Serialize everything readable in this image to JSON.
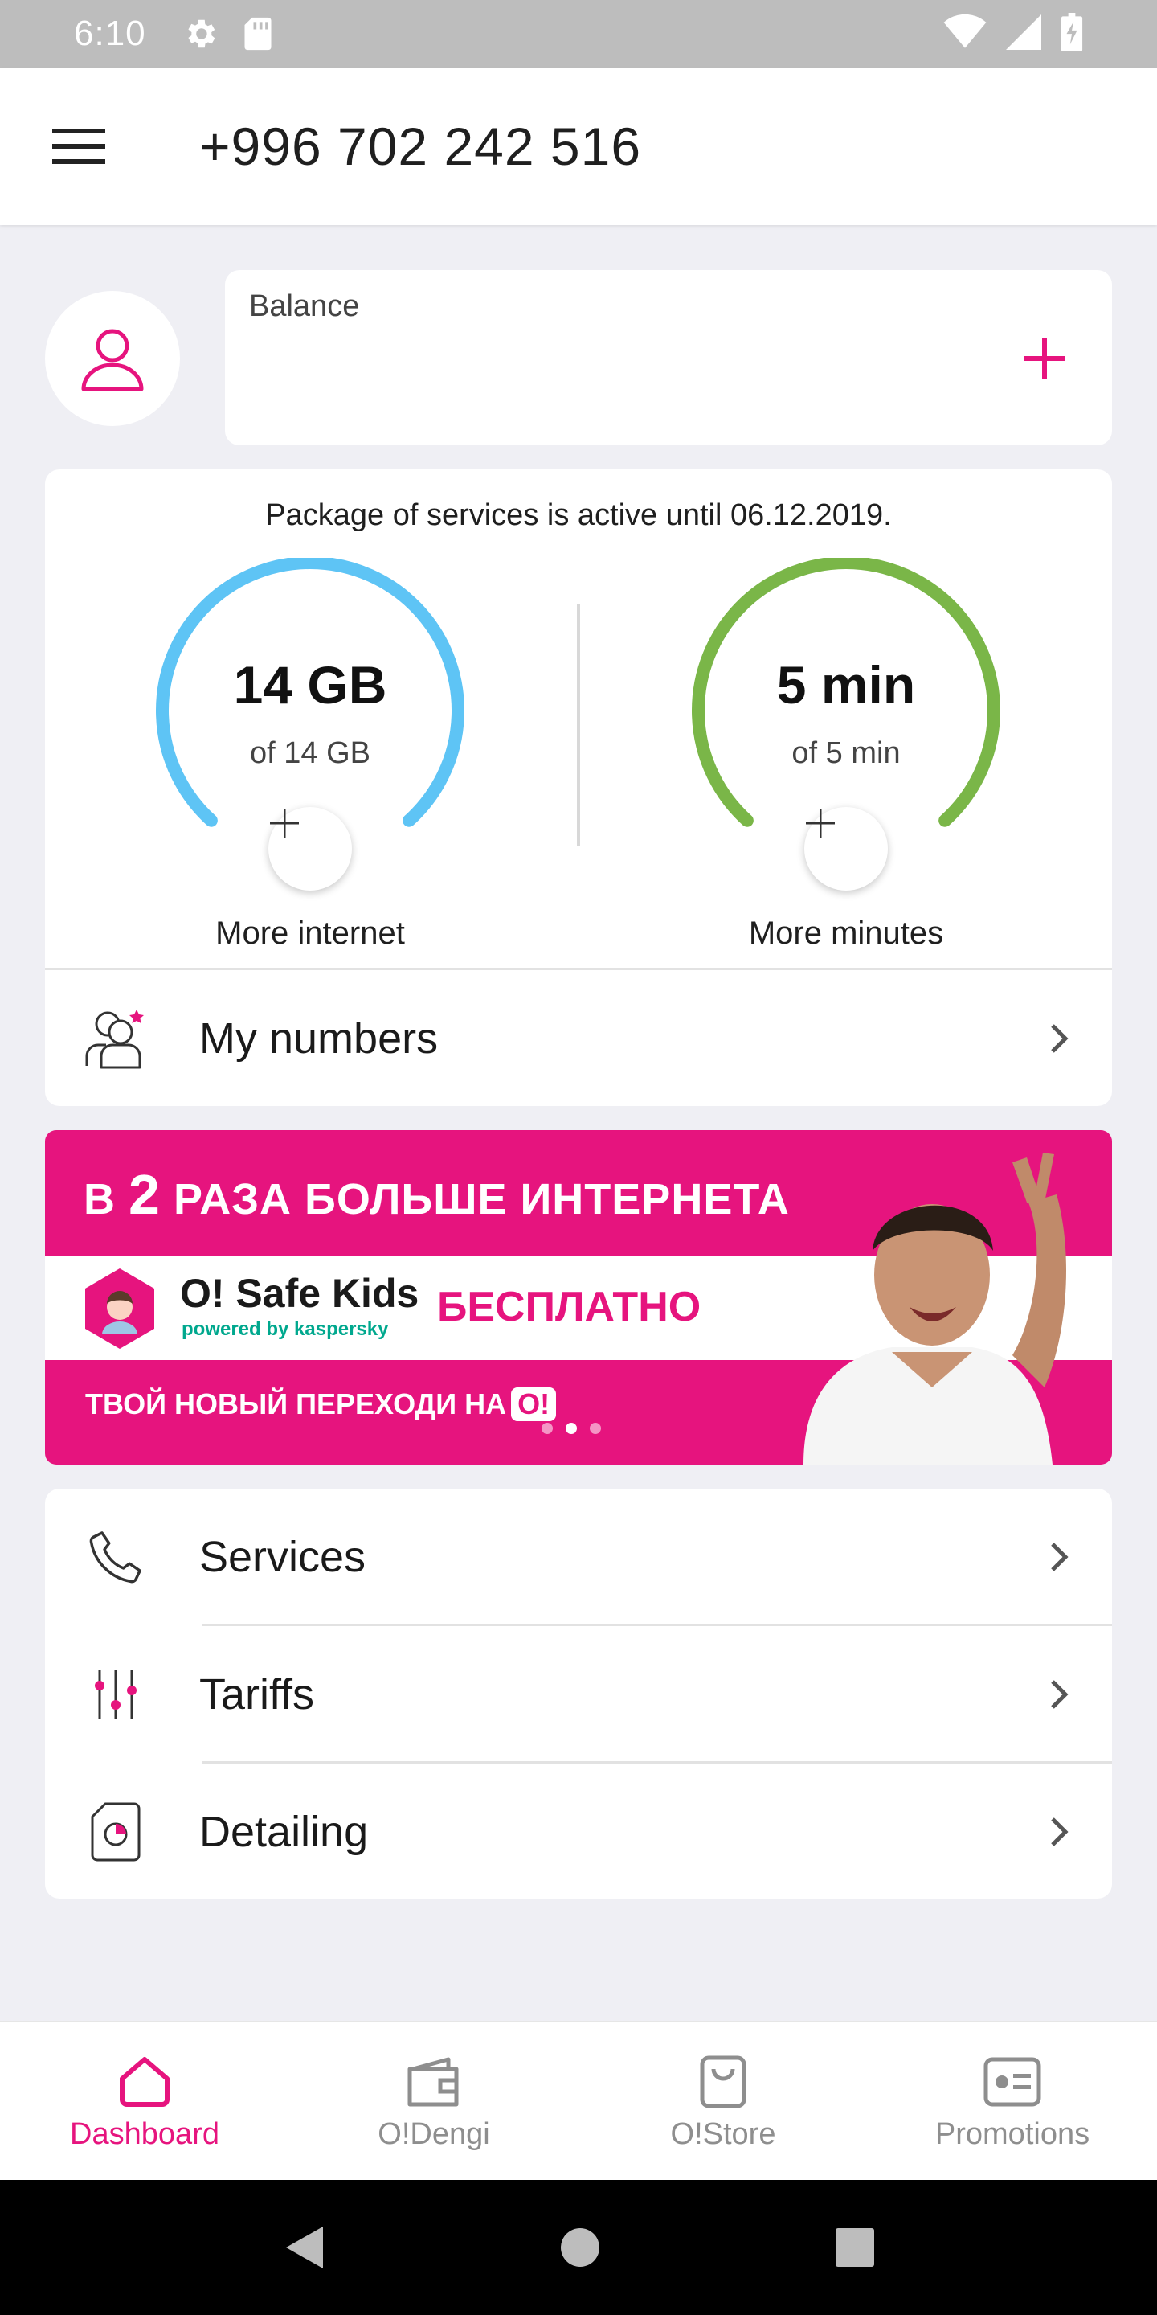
{
  "status_bar": {
    "time": "6:10"
  },
  "header": {
    "phone_number": "+996 702 242 516"
  },
  "balance": {
    "label": "Balance"
  },
  "package": {
    "status_text": "Package of services is active until 06.12.2019.",
    "internet": {
      "value": "14 GB",
      "of": "of 14 GB",
      "label": "More internet",
      "remaining_fraction": 1.0,
      "color": "#5ec4f5"
    },
    "minutes": {
      "value": "5 min",
      "of": "of 5 min",
      "label": "More minutes",
      "remaining_fraction": 1.0,
      "color": "#7ab648"
    }
  },
  "my_numbers": {
    "label": "My numbers"
  },
  "banner": {
    "headline_prefix": "В ",
    "headline_number": "2",
    "headline_rest": " РАЗА БОЛЬШЕ ИНТЕРНЕТА",
    "kids_title": "O! Safe Kids",
    "kids_powered": "powered by kaspersky",
    "free": "БЕСПЛАТНО",
    "bottom_text": "ТВОЙ НОВЫЙ ПЕРЕХОДИ НА",
    "logo": "O!"
  },
  "menu": {
    "items": [
      {
        "label": "Services",
        "icon": "phone-icon"
      },
      {
        "label": "Tariffs",
        "icon": "sliders-icon"
      },
      {
        "label": "Detailing",
        "icon": "document-chart-icon"
      }
    ]
  },
  "bottom_nav": {
    "items": [
      {
        "label": "Dashboard",
        "icon": "home-icon",
        "active": true
      },
      {
        "label": "O!Dengi",
        "icon": "wallet-icon",
        "active": false
      },
      {
        "label": "O!Store",
        "icon": "shopping-bag-icon",
        "active": false
      },
      {
        "label": "Promotions",
        "icon": "promo-card-icon",
        "active": false
      }
    ]
  },
  "colors": {
    "accent": "#e6147e",
    "background": "#efeff4",
    "status_bar": "#bdbdbd"
  }
}
